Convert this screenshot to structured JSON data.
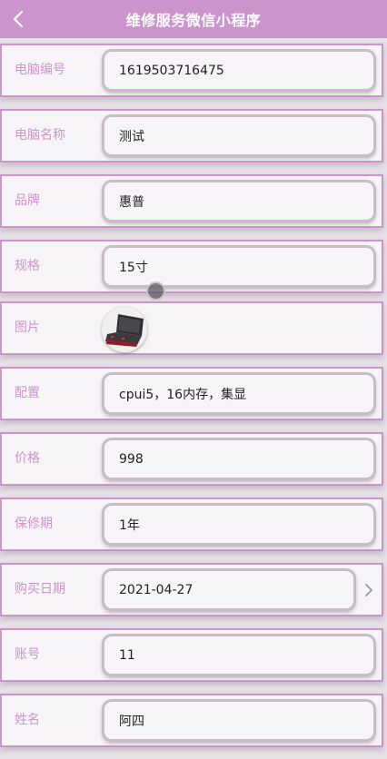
{
  "header": {
    "title": "维修服务微信小程序",
    "back_icon": "chevron-left-icon"
  },
  "fields": [
    {
      "label": "电脑编号",
      "value": "1619503716475"
    },
    {
      "label": "电脑名称",
      "value": "测试"
    },
    {
      "label": "品牌",
      "value": "惠普"
    },
    {
      "label": "规格",
      "value": "15寸"
    },
    {
      "label": "图片",
      "value": ""
    },
    {
      "label": "配置",
      "value": "cpui5，16内存，集显"
    },
    {
      "label": "价格",
      "value": "998"
    },
    {
      "label": "保修期",
      "value": "1年"
    },
    {
      "label": "购买日期",
      "value": "2021-04-27"
    },
    {
      "label": "账号",
      "value": "11"
    },
    {
      "label": "姓名",
      "value": "阿四"
    }
  ],
  "colors": {
    "accent": "#cc94cc",
    "row_background": "#f6f4f6",
    "page_background": "#e6e2e6",
    "text": "#222222"
  }
}
